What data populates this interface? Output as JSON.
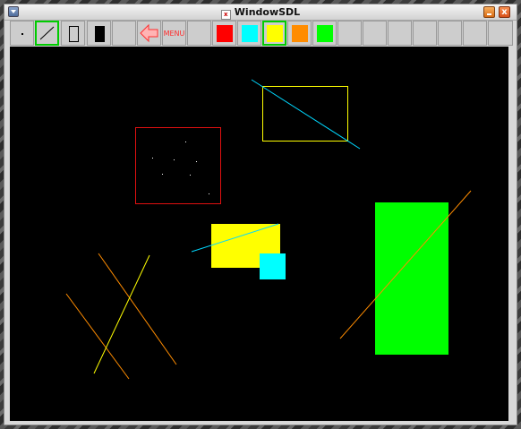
{
  "window": {
    "title": "WindowSDL",
    "close_glyph": "x"
  },
  "toolbar": {
    "tools": [
      {
        "name": "point-tool",
        "icon": "dot-icon"
      },
      {
        "name": "line-tool",
        "icon": "diagonal-line-icon",
        "selected": true
      },
      {
        "name": "rectangle-outline-tool",
        "icon": "rectangle-outline-icon"
      },
      {
        "name": "filled-rectangle-tool",
        "icon": "filled-rectangle-icon"
      },
      {
        "name": "blank-tool-slot",
        "icon": ""
      },
      {
        "name": "back-arrow-button",
        "icon": "left-arrow-icon"
      }
    ],
    "menu_label": "MENU",
    "colors": [
      {
        "name": "red",
        "hex": "#ff0000"
      },
      {
        "name": "cyan",
        "hex": "#00ffff"
      },
      {
        "name": "yellow",
        "hex": "#ffff00",
        "selected": true
      },
      {
        "name": "orange",
        "hex": "#ff8c00"
      },
      {
        "name": "green",
        "hex": "#00ff00"
      }
    ],
    "accent_color": "#00cc00"
  },
  "canvas": {
    "background": "#000000"
  }
}
